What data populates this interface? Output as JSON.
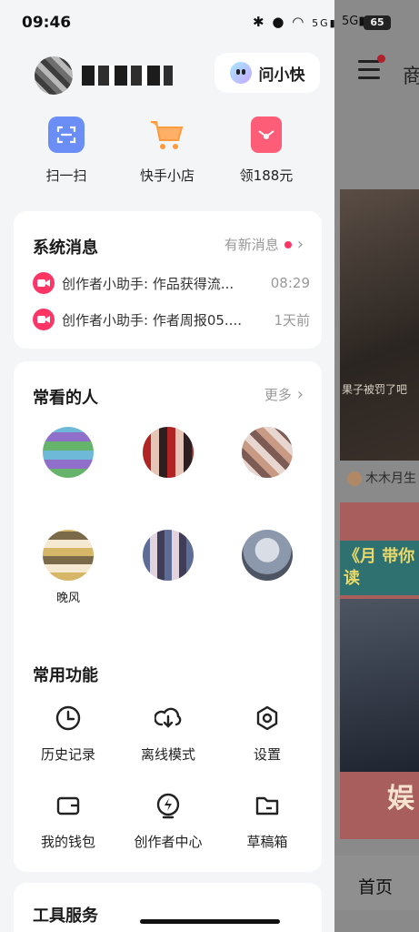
{
  "status_bar": {
    "time": "09:46",
    "icons_text": "✱ ⚲ ᯤ 5G 5G",
    "battery": "65"
  },
  "profile": {
    "ask_button_label": "问小快"
  },
  "quick_actions": [
    {
      "label": "扫一扫",
      "icon": "scan-icon",
      "color": "#6a8ef5"
    },
    {
      "label": "快手小店",
      "icon": "cart-icon",
      "color": "#ff9b3d"
    },
    {
      "label": "领188元",
      "icon": "red-envelope-icon",
      "color": "#fe3666"
    }
  ],
  "messages_card": {
    "title": "系统消息",
    "more_label": "有新消息",
    "items": [
      {
        "text": "创作者小助手: 作品获得流...",
        "time": "08:29"
      },
      {
        "text": "创作者小助手: 作者周报05....",
        "time": "1天前"
      }
    ]
  },
  "people_card": {
    "title": "常看的人",
    "more_label": "更多",
    "people": [
      {
        "name": "",
        "sub": "",
        "avatar": "mosaic1"
      },
      {
        "name": "",
        "sub": "",
        "avatar": "mosaic2"
      },
      {
        "name": "",
        "sub": "",
        "avatar": "mosaic3"
      },
      {
        "name": "晚风",
        "sub": "",
        "avatar": "mosaic4"
      },
      {
        "name": "",
        "sub": "",
        "avatar": "mosaic5"
      },
      {
        "name": "",
        "sub": "",
        "avatar": "mosaic6"
      }
    ]
  },
  "functions_card": {
    "title": "常用功能",
    "items": [
      {
        "label": "历史记录",
        "icon": "clock-icon"
      },
      {
        "label": "离线模式",
        "icon": "cloud-download-icon"
      },
      {
        "label": "设置",
        "icon": "settings-hex-icon"
      },
      {
        "label": "我的钱包",
        "icon": "wallet-icon"
      },
      {
        "label": "创作者中心",
        "icon": "lightning-icon"
      },
      {
        "label": "草稿箱",
        "icon": "folder-icon"
      }
    ]
  },
  "tools_card": {
    "title": "工具服务"
  },
  "background_app": {
    "tab_label": "商",
    "card_caption": "果子被罚了吧",
    "author": "木木月生",
    "banner_text": "《月 带你读",
    "big_text": "娱",
    "bottom_tab": "首页"
  },
  "colors": {
    "accent": "#fe3666",
    "panel_bg": "#f4f5f7",
    "card_bg": "#ffffff"
  }
}
